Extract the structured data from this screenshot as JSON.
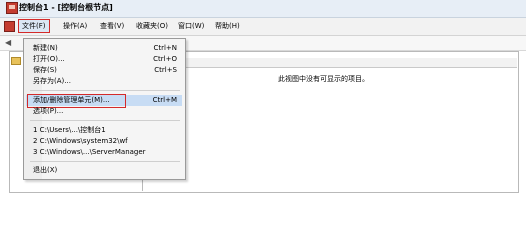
{
  "window": {
    "title": "控制台1 - [控制台根节点]"
  },
  "menubar": {
    "items": [
      {
        "label": "文件(F)"
      },
      {
        "label": "操作(A)"
      },
      {
        "label": "查看(V)"
      },
      {
        "label": "收藏夹(O)"
      },
      {
        "label": "窗口(W)"
      },
      {
        "label": "帮助(H)"
      }
    ]
  },
  "file_menu": {
    "new": {
      "label": "新建(N)",
      "shortcut": "Ctrl+N"
    },
    "open": {
      "label": "打开(O)...",
      "shortcut": "Ctrl+O"
    },
    "save": {
      "label": "保存(S)",
      "shortcut": "Ctrl+S"
    },
    "save_as": {
      "label": "另存为(A)..."
    },
    "add_remove": {
      "label": "添加/删除管理单元(M)...",
      "shortcut": "Ctrl+M"
    },
    "options": {
      "label": "选项(P)..."
    },
    "recent": [
      {
        "label": "1 C:\\Users\\...\\控制台1"
      },
      {
        "label": "2 C:\\Windows\\system32\\wf"
      },
      {
        "label": "3 C:\\Windows\\...\\ServerManager"
      }
    ],
    "exit": {
      "label": "退出(X)"
    }
  },
  "main": {
    "empty_message": "此视图中没有可显示的项目。"
  }
}
